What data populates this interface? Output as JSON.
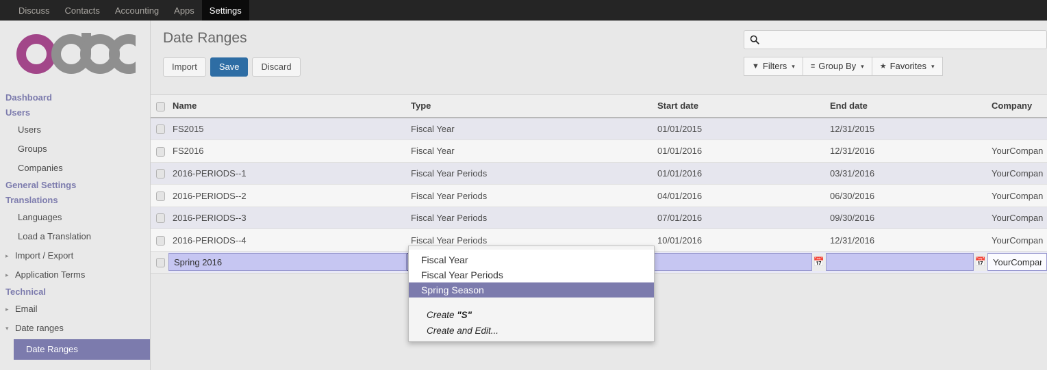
{
  "navbar": {
    "items": [
      {
        "label": "Discuss",
        "active": false
      },
      {
        "label": "Contacts",
        "active": false
      },
      {
        "label": "Accounting",
        "active": false
      },
      {
        "label": "Apps",
        "active": false
      },
      {
        "label": "Settings",
        "active": true
      }
    ]
  },
  "brand": {
    "name": "odoo",
    "accent_color": "#a24689",
    "gray_color": "#8f8f8f"
  },
  "sidebar": {
    "items": [
      {
        "label": "Dashboard",
        "type": "section"
      },
      {
        "label": "Users",
        "type": "section"
      },
      {
        "label": "Users",
        "type": "leaf"
      },
      {
        "label": "Groups",
        "type": "leaf"
      },
      {
        "label": "Companies",
        "type": "leaf"
      },
      {
        "label": "General Settings",
        "type": "section"
      },
      {
        "label": "Translations",
        "type": "section"
      },
      {
        "label": "Languages",
        "type": "leaf"
      },
      {
        "label": "Load a Translation",
        "type": "leaf"
      },
      {
        "label": "Import / Export",
        "type": "folder",
        "caret": "▸"
      },
      {
        "label": "Application Terms",
        "type": "folder",
        "caret": "▸"
      },
      {
        "label": "Technical",
        "type": "section"
      },
      {
        "label": "Email",
        "type": "folder",
        "caret": "▸"
      },
      {
        "label": "Date ranges",
        "type": "folder",
        "caret": "▾"
      },
      {
        "label": "Date Ranges",
        "type": "child",
        "active": true
      }
    ],
    "active_color": "#7c7bad"
  },
  "header": {
    "title": "Date Ranges",
    "buttons": [
      {
        "label": "Import",
        "style": "default"
      },
      {
        "label": "Save",
        "style": "primary"
      },
      {
        "label": "Discard",
        "style": "default"
      }
    ],
    "primary_color": "#2e6da4"
  },
  "search": {
    "value": "",
    "placeholder": "",
    "icon": "search-icon"
  },
  "filters": [
    {
      "label": "Filters",
      "icon": "filter-icon",
      "glyph": "▼"
    },
    {
      "label": "Group By",
      "icon": "list-icon",
      "glyph": "≡"
    },
    {
      "label": "Favorites",
      "icon": "star-icon",
      "glyph": "★"
    }
  ],
  "table": {
    "columns": [
      "Name",
      "Type",
      "Start date",
      "End date",
      "Company"
    ],
    "rows": [
      {
        "name": "FS2015",
        "type": "Fiscal Year",
        "start": "01/01/2015",
        "end": "12/31/2015",
        "company": ""
      },
      {
        "name": "FS2016",
        "type": "Fiscal Year",
        "start": "01/01/2016",
        "end": "12/31/2016",
        "company": "YourCompan"
      },
      {
        "name": "2016-PERIODS--1",
        "type": "Fiscal Year Periods",
        "start": "01/01/2016",
        "end": "03/31/2016",
        "company": "YourCompan"
      },
      {
        "name": "2016-PERIODS--2",
        "type": "Fiscal Year Periods",
        "start": "04/01/2016",
        "end": "06/30/2016",
        "company": "YourCompan"
      },
      {
        "name": "2016-PERIODS--3",
        "type": "Fiscal Year Periods",
        "start": "07/01/2016",
        "end": "09/30/2016",
        "company": "YourCompan"
      },
      {
        "name": "2016-PERIODS--4",
        "type": "Fiscal Year Periods",
        "start": "10/01/2016",
        "end": "12/31/2016",
        "company": "YourCompan"
      }
    ],
    "editing_row": {
      "name": "Spring 2016",
      "type": "S",
      "start": "",
      "end": "",
      "company": "YourCompan",
      "calendar_icon": "📅"
    }
  },
  "dropdown": {
    "options": [
      {
        "label": "Fiscal Year",
        "highlighted": false
      },
      {
        "label": "Fiscal Year Periods",
        "highlighted": false
      },
      {
        "label": "Spring Season",
        "highlighted": true
      }
    ],
    "create_items": [
      {
        "prefix": "Create ",
        "quoted": "\"S\"",
        "suffix": ""
      },
      {
        "prefix": "Create and Edit...",
        "quoted": "",
        "suffix": ""
      }
    ],
    "highlight_color": "#7c7bad"
  }
}
